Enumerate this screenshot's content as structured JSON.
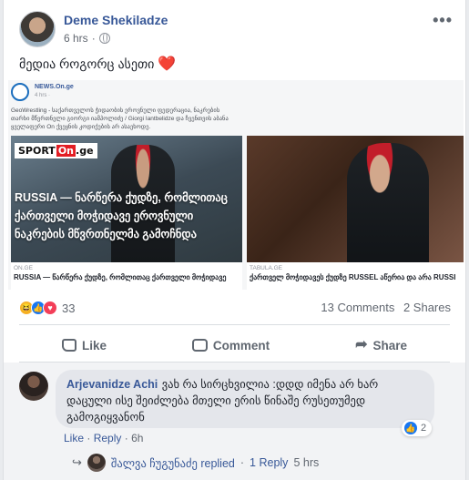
{
  "post": {
    "author": "Deme Shekiladze",
    "time": "6 hrs",
    "separator": "·",
    "more": "•••",
    "status_text": "მედია როგორც ასეთი",
    "status_emoji": "❤️"
  },
  "embed": {
    "source_name": "NEWS.On.ge",
    "source_time": "4 hrs ·",
    "text": "GeoWrestling - საქართველოს ჭიდაობის ეროვნული ფედერაცია, ნაკრების თარხი მწვრთნელი გიორგი იამპოლიძე / Giorgi Iantbelidze და ჩვენთვის აბანა ყველაფერი On ქვეყნის კოდიქების არ ასაეხოდე.",
    "card1": {
      "logo_text": "SPORT",
      "logo_on": "On",
      "logo_suffix": ".ge",
      "headline": "RUSSIA — ნარწერა ქუდზე, რომლითაც ქართველი მოჭიდავე ეროვნული ნაკრების მწვრთნელმა გამოჩნდა",
      "caption_source": "ON.GE",
      "caption_title": "RUSSIA — წარწერა ქუდზე, რომლითაც ქართველი მოჭიდავე"
    },
    "card2": {
      "caption_source": "TABULA.GE",
      "caption_title": "ქართველ მოჭიდავეს ქუდზე RUSSEL აწერია და არა RUSSI"
    }
  },
  "stats": {
    "reaction_count": "33",
    "comments": "13 Comments",
    "shares": "2 Shares"
  },
  "actions": {
    "like": "Like",
    "comment": "Comment",
    "share": "Share"
  },
  "comment": {
    "author": "Arjevanidze Achi",
    "text": "ვახ რა სირცხვილია :დდდ იმენა არ ხარ დაცული ისე შეიძლება მთელი ერის წინაშე რუსეთუმედ გამოგიყვანონ",
    "reaction_count": "2",
    "like": "Like",
    "reply": "Reply",
    "dot": "·",
    "time": "6h"
  },
  "reply_summary": {
    "arrow": "↪",
    "name": "შალვა ჩუგუნაძე replied",
    "dot": "·",
    "count": "1 Reply",
    "time": "5 hrs"
  },
  "colors": {
    "link": "#385898",
    "like_blue": "#1877f2",
    "love_red": "#f33e58",
    "haha_yellow": "#f7b125"
  }
}
